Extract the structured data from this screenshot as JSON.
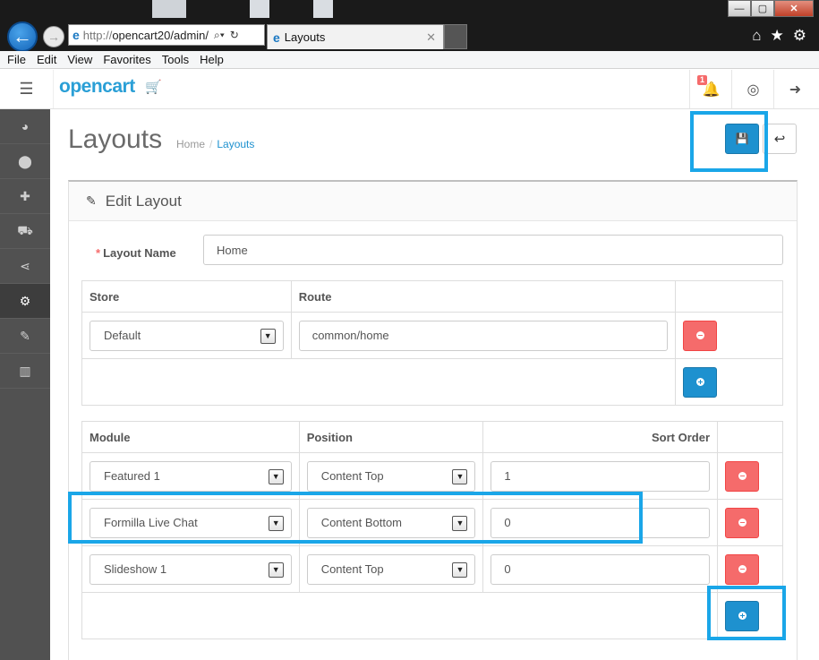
{
  "browser": {
    "url_proto": "http://",
    "url_host": "opencart20/admin/",
    "tab_title": "Layouts",
    "min": "—",
    "max": "▢",
    "close": "✕"
  },
  "menubar": [
    "File",
    "Edit",
    "View",
    "Favorites",
    "Tools",
    "Help"
  ],
  "header": {
    "logo": "opencart",
    "notification_count": "1"
  },
  "sidebar_icons": [
    "dashboard-icon",
    "tags-icon",
    "puzzle-icon",
    "cart-icon",
    "share-icon",
    "cog-icon",
    "wrench-icon",
    "bar-chart-icon"
  ],
  "page": {
    "title": "Layouts",
    "breadcrumb": [
      "Home",
      "Layouts"
    ]
  },
  "panel": {
    "heading": "Edit Layout",
    "layout_name_label": "Layout Name",
    "layout_name_value": "Home"
  },
  "route_table": {
    "headers": [
      "Store",
      "Route"
    ],
    "rows": [
      {
        "store": "Default",
        "route": "common/home"
      }
    ]
  },
  "module_table": {
    "headers": [
      "Module",
      "Position",
      "Sort Order"
    ],
    "rows": [
      {
        "module": "Featured 1",
        "position": "Content Top",
        "sort_order": "1"
      },
      {
        "module": "Formilla Live Chat",
        "position": "Content Bottom",
        "sort_order": "0"
      },
      {
        "module": "Slideshow 1",
        "position": "Content Top",
        "sort_order": "0"
      }
    ]
  },
  "colors": {
    "primary": "#1e91cf",
    "danger": "#f56b6b",
    "highlight": "#1aa6e8",
    "sidebar": "#515151"
  }
}
